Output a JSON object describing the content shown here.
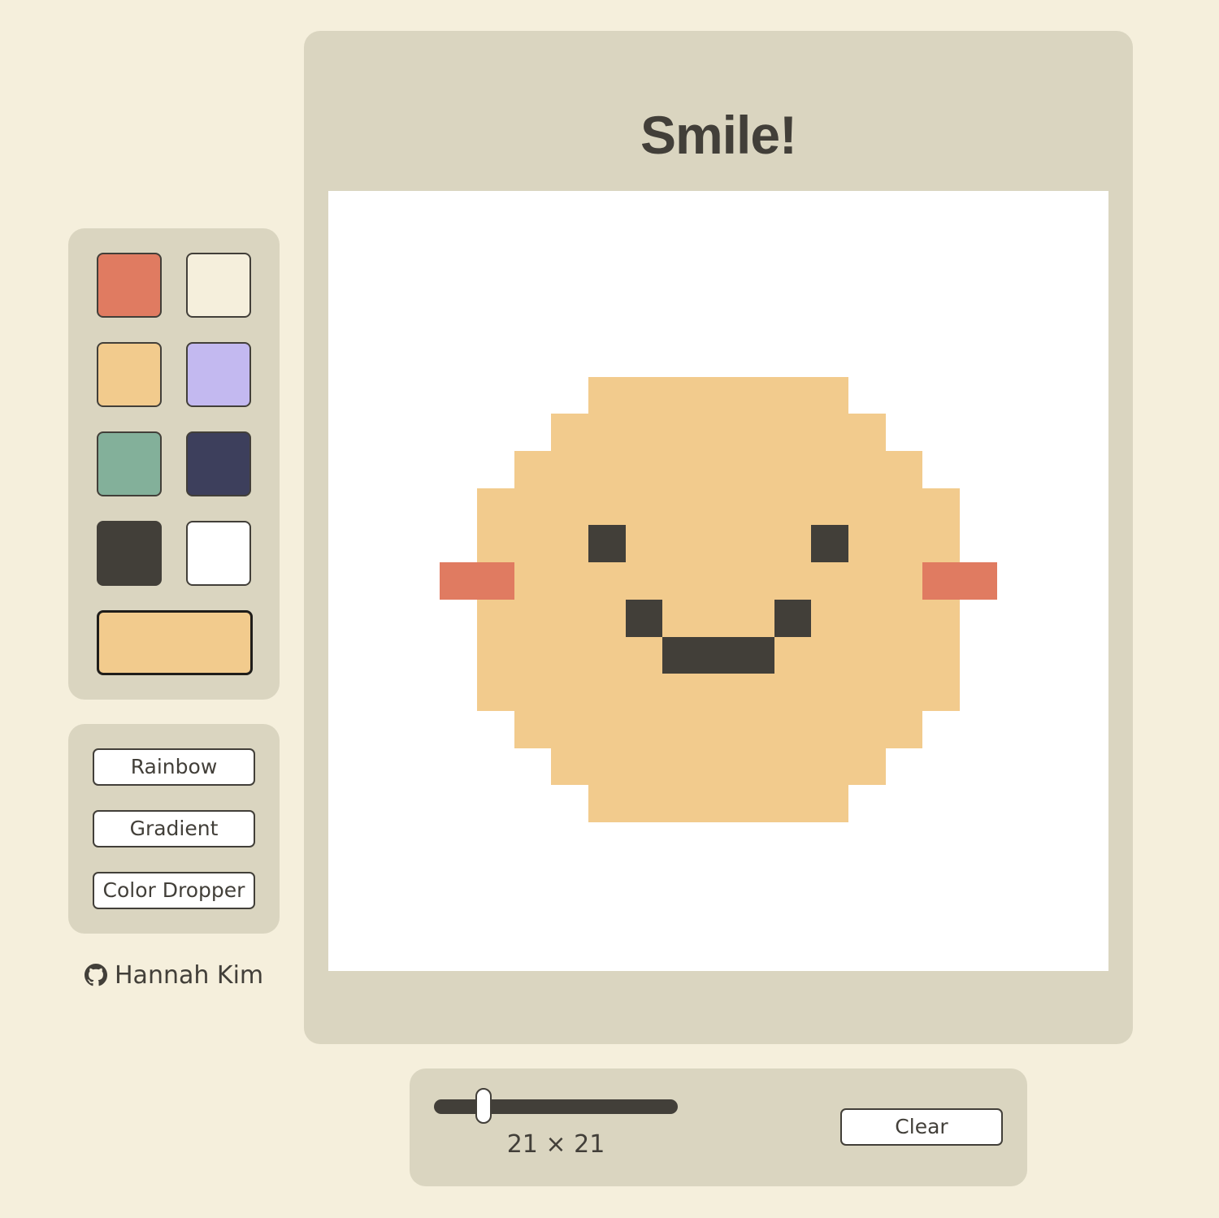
{
  "palette": {
    "swatches": [
      {
        "name": "coral",
        "color": "#e07b61"
      },
      {
        "name": "cream",
        "color": "#f5efdc"
      },
      {
        "name": "peach",
        "color": "#f2cb8d"
      },
      {
        "name": "lavender",
        "color": "#c3b9f0"
      },
      {
        "name": "sage",
        "color": "#83b09a"
      },
      {
        "name": "navy",
        "color": "#3d3f5c"
      },
      {
        "name": "charcoal",
        "color": "#423f39"
      },
      {
        "name": "white",
        "color": "#ffffff"
      }
    ],
    "current_color": "#f2cb8d"
  },
  "tools": {
    "rainbow_label": "Rainbow",
    "gradient_label": "Gradient",
    "dropper_label": "Color Dropper"
  },
  "author": {
    "icon": "github-icon",
    "name": "Hannah Kim"
  },
  "canvas": {
    "title": "Smile!",
    "background": "#ffffff",
    "legend": {
      ".": "#ffffff",
      "P": "#f2cb8d",
      "D": "#423f39",
      "C": "#e07b61"
    },
    "rows": [
      ".....................",
      ".....................",
      ".....................",
      ".....................",
      ".....................",
      ".......PPPPPPP.......",
      "......PPPPPPPPP......",
      ".....PPPPPPPPPPP.....",
      "....PPPPPPPPPPPPP....",
      "....PPPDPPPPPDPPP....",
      "...CCPPPPPPPPPPPCC...",
      "....PPPPDPPPDPPPP....",
      "....PPPPPDDDPPPPP....",
      "....PPPPPPPPPPPPP....",
      ".....PPPPPPPPPPP.....",
      "......PPPPPPPPP......",
      ".......PPPPPPP.......",
      ".....................",
      ".....................",
      ".....................",
      "....................."
    ]
  },
  "grid_size": {
    "value": 21,
    "min": 16,
    "max": 64,
    "label": "21 × 21"
  },
  "clear_label": "Clear"
}
